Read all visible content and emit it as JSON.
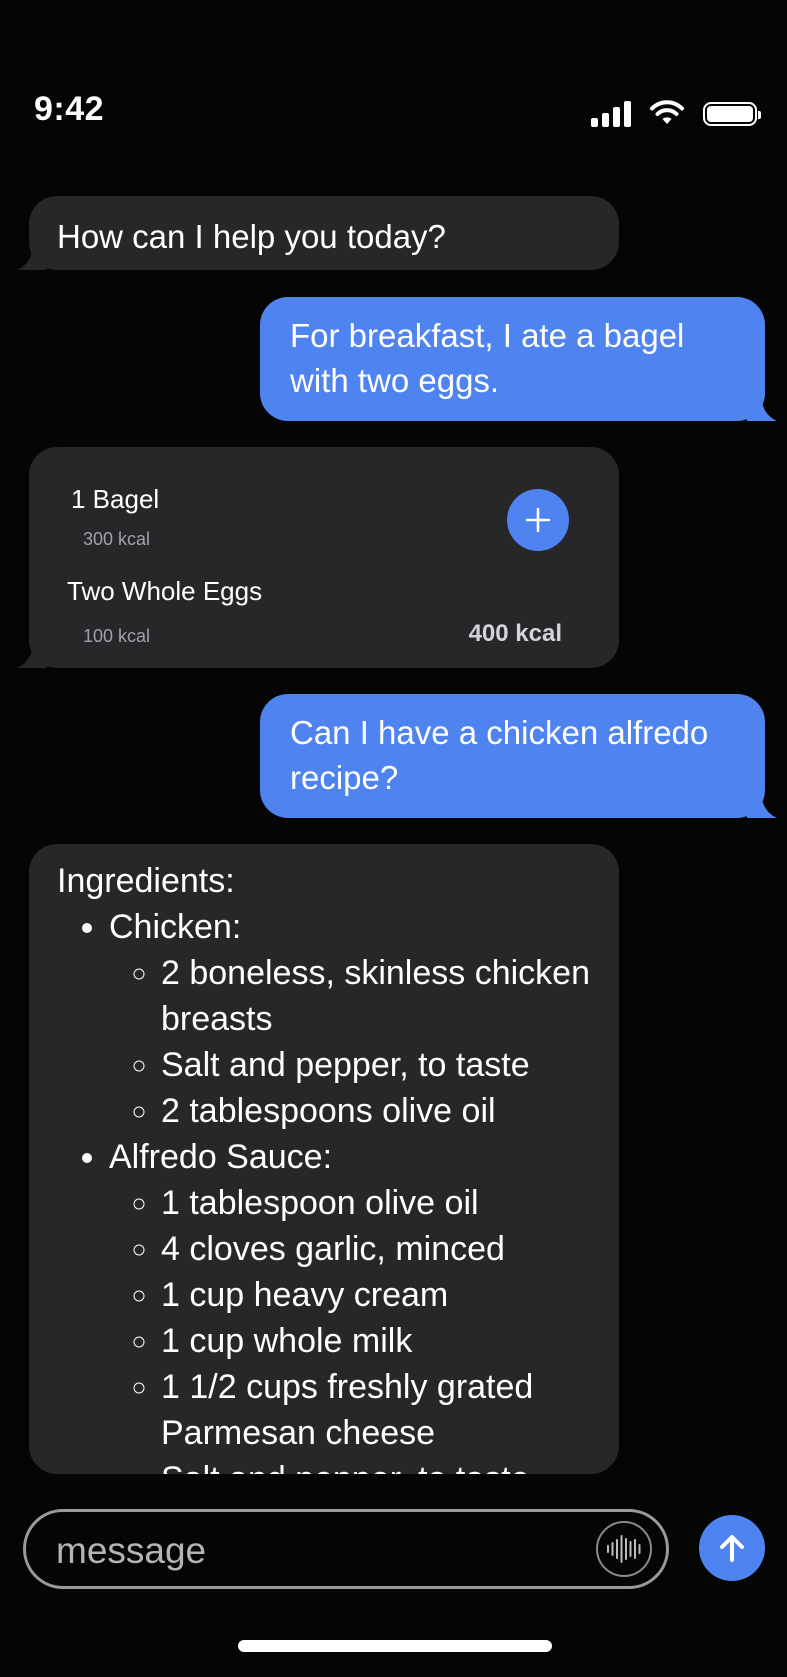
{
  "status": {
    "time": "9:42"
  },
  "messages": {
    "m1": "How can I help you today?",
    "m2": "For breakfast, I ate a bagel with two eggs.",
    "m3": "Can I have a chicken alfredo recipe?"
  },
  "nutrition_card": {
    "items": [
      {
        "name": "1 Bagel",
        "kcal": "300 kcal"
      },
      {
        "name": "Two Whole Eggs",
        "kcal": "100 kcal"
      }
    ],
    "total": "400 kcal"
  },
  "recipe": {
    "title": "Ingredients:",
    "sections": [
      {
        "name": "Chicken:",
        "items": [
          "2 boneless, skinless chicken breasts",
          "Salt and pepper, to taste",
          "2 tablespoons olive oil"
        ]
      },
      {
        "name": "Alfredo Sauce:",
        "items": [
          "1 tablespoon olive oil",
          "4 cloves garlic, minced",
          "1 cup heavy cream",
          "1 cup whole milk",
          "1 1/2 cups freshly grated Parmesan cheese",
          "Salt and pepper, to taste"
        ]
      }
    ]
  },
  "composer": {
    "placeholder": "message"
  },
  "colors": {
    "accent": "#4f83f0",
    "bot_bubble": "#27272a",
    "background": "#050505"
  }
}
